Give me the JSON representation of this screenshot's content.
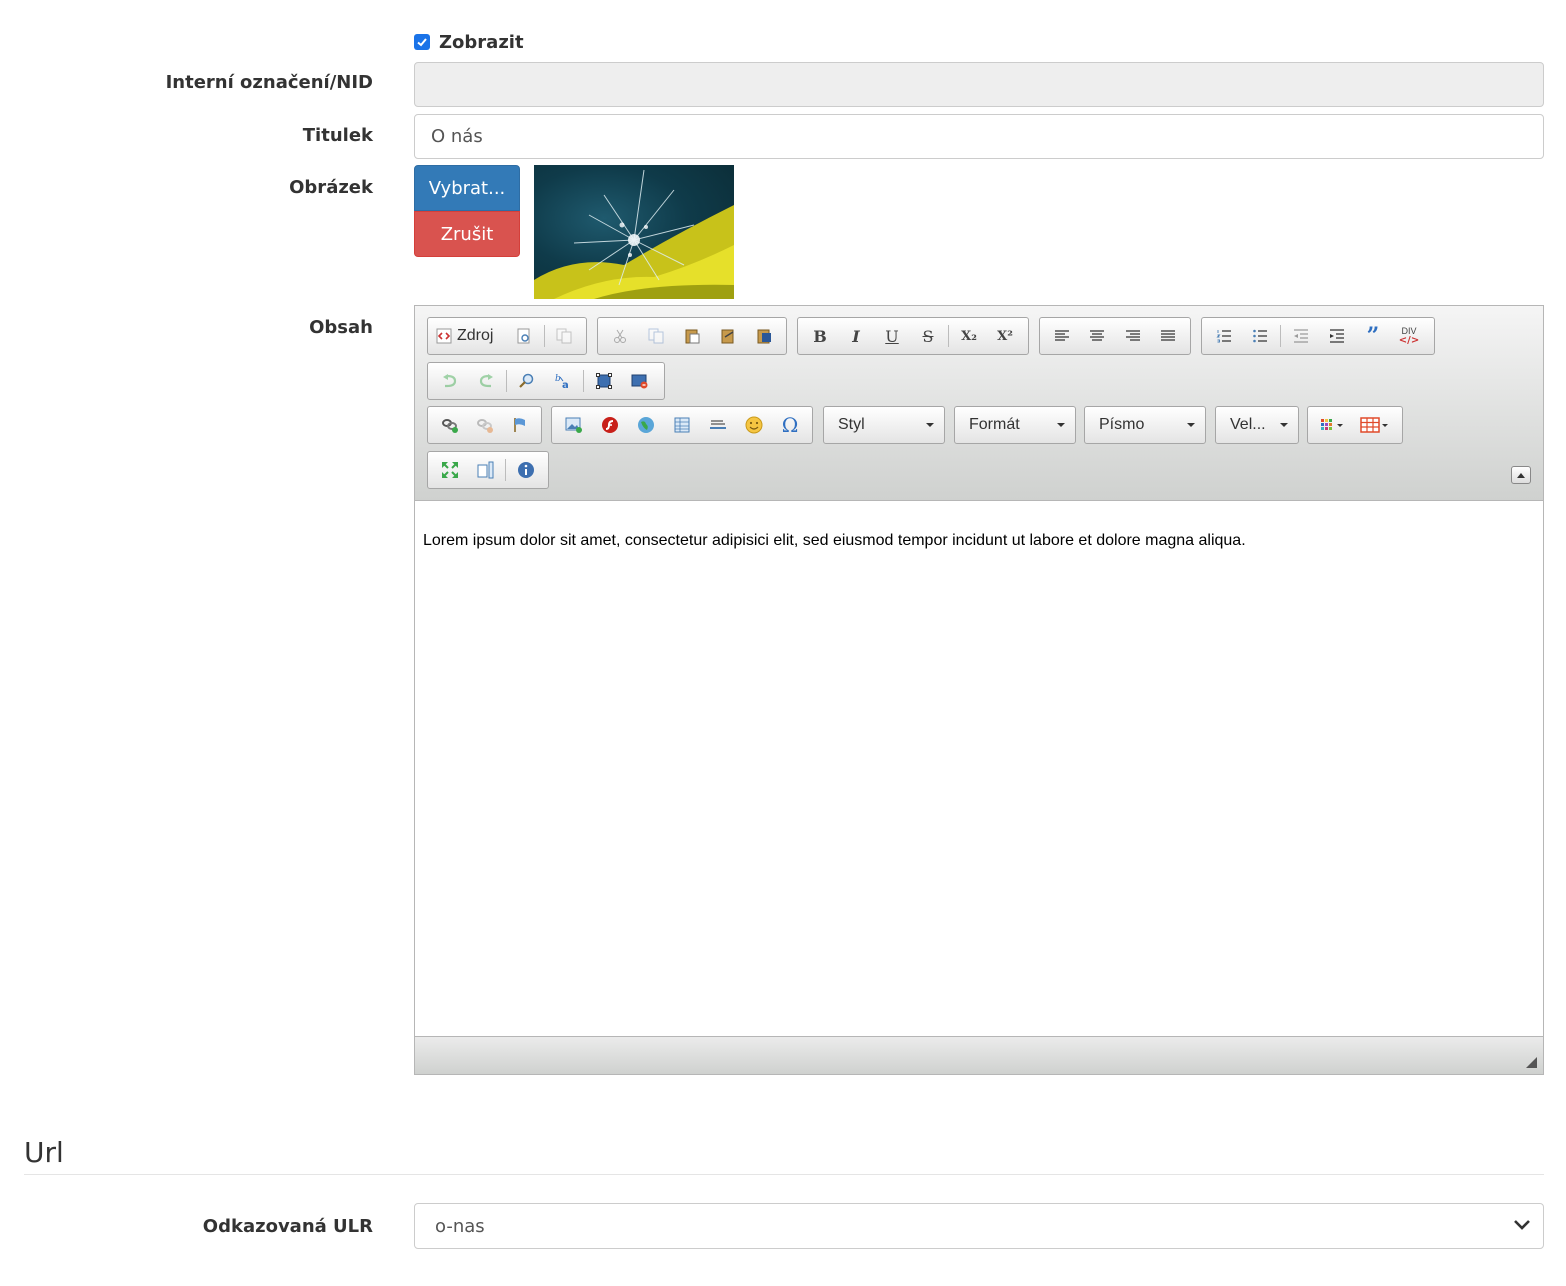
{
  "form": {
    "show": {
      "label": "Zobrazit",
      "checked": true
    },
    "nid": {
      "label": "Interní označení/NID",
      "value": ""
    },
    "title": {
      "label": "Titulek",
      "value": "O nás"
    },
    "image": {
      "label": "Obrázek",
      "select_label": "Vybrat...",
      "cancel_label": "Zrušit"
    },
    "content": {
      "label": "Obsah",
      "text": "Lorem ipsum dolor sit amet, consectetur adipisici elit, sed eiusmod tempor incidunt ut labore et dolore magna aliqua."
    }
  },
  "editor": {
    "source_label": "Zdroj",
    "bold": "B",
    "italic": "I",
    "underline": "U",
    "strike": "S",
    "subscript": "X₂",
    "superscript": "X²",
    "div_label": "DIV",
    "combos": {
      "style": "Styl",
      "format": "Formát",
      "font": "Písmo",
      "size": "Vel..."
    }
  },
  "url_section": {
    "title": "Url",
    "linked_url": {
      "label": "Odkazovaná ULR",
      "value": "o-nas"
    }
  },
  "colors": {
    "primary": "#337ab7",
    "danger": "#d9534f",
    "checkbox": "#1a73e8"
  }
}
